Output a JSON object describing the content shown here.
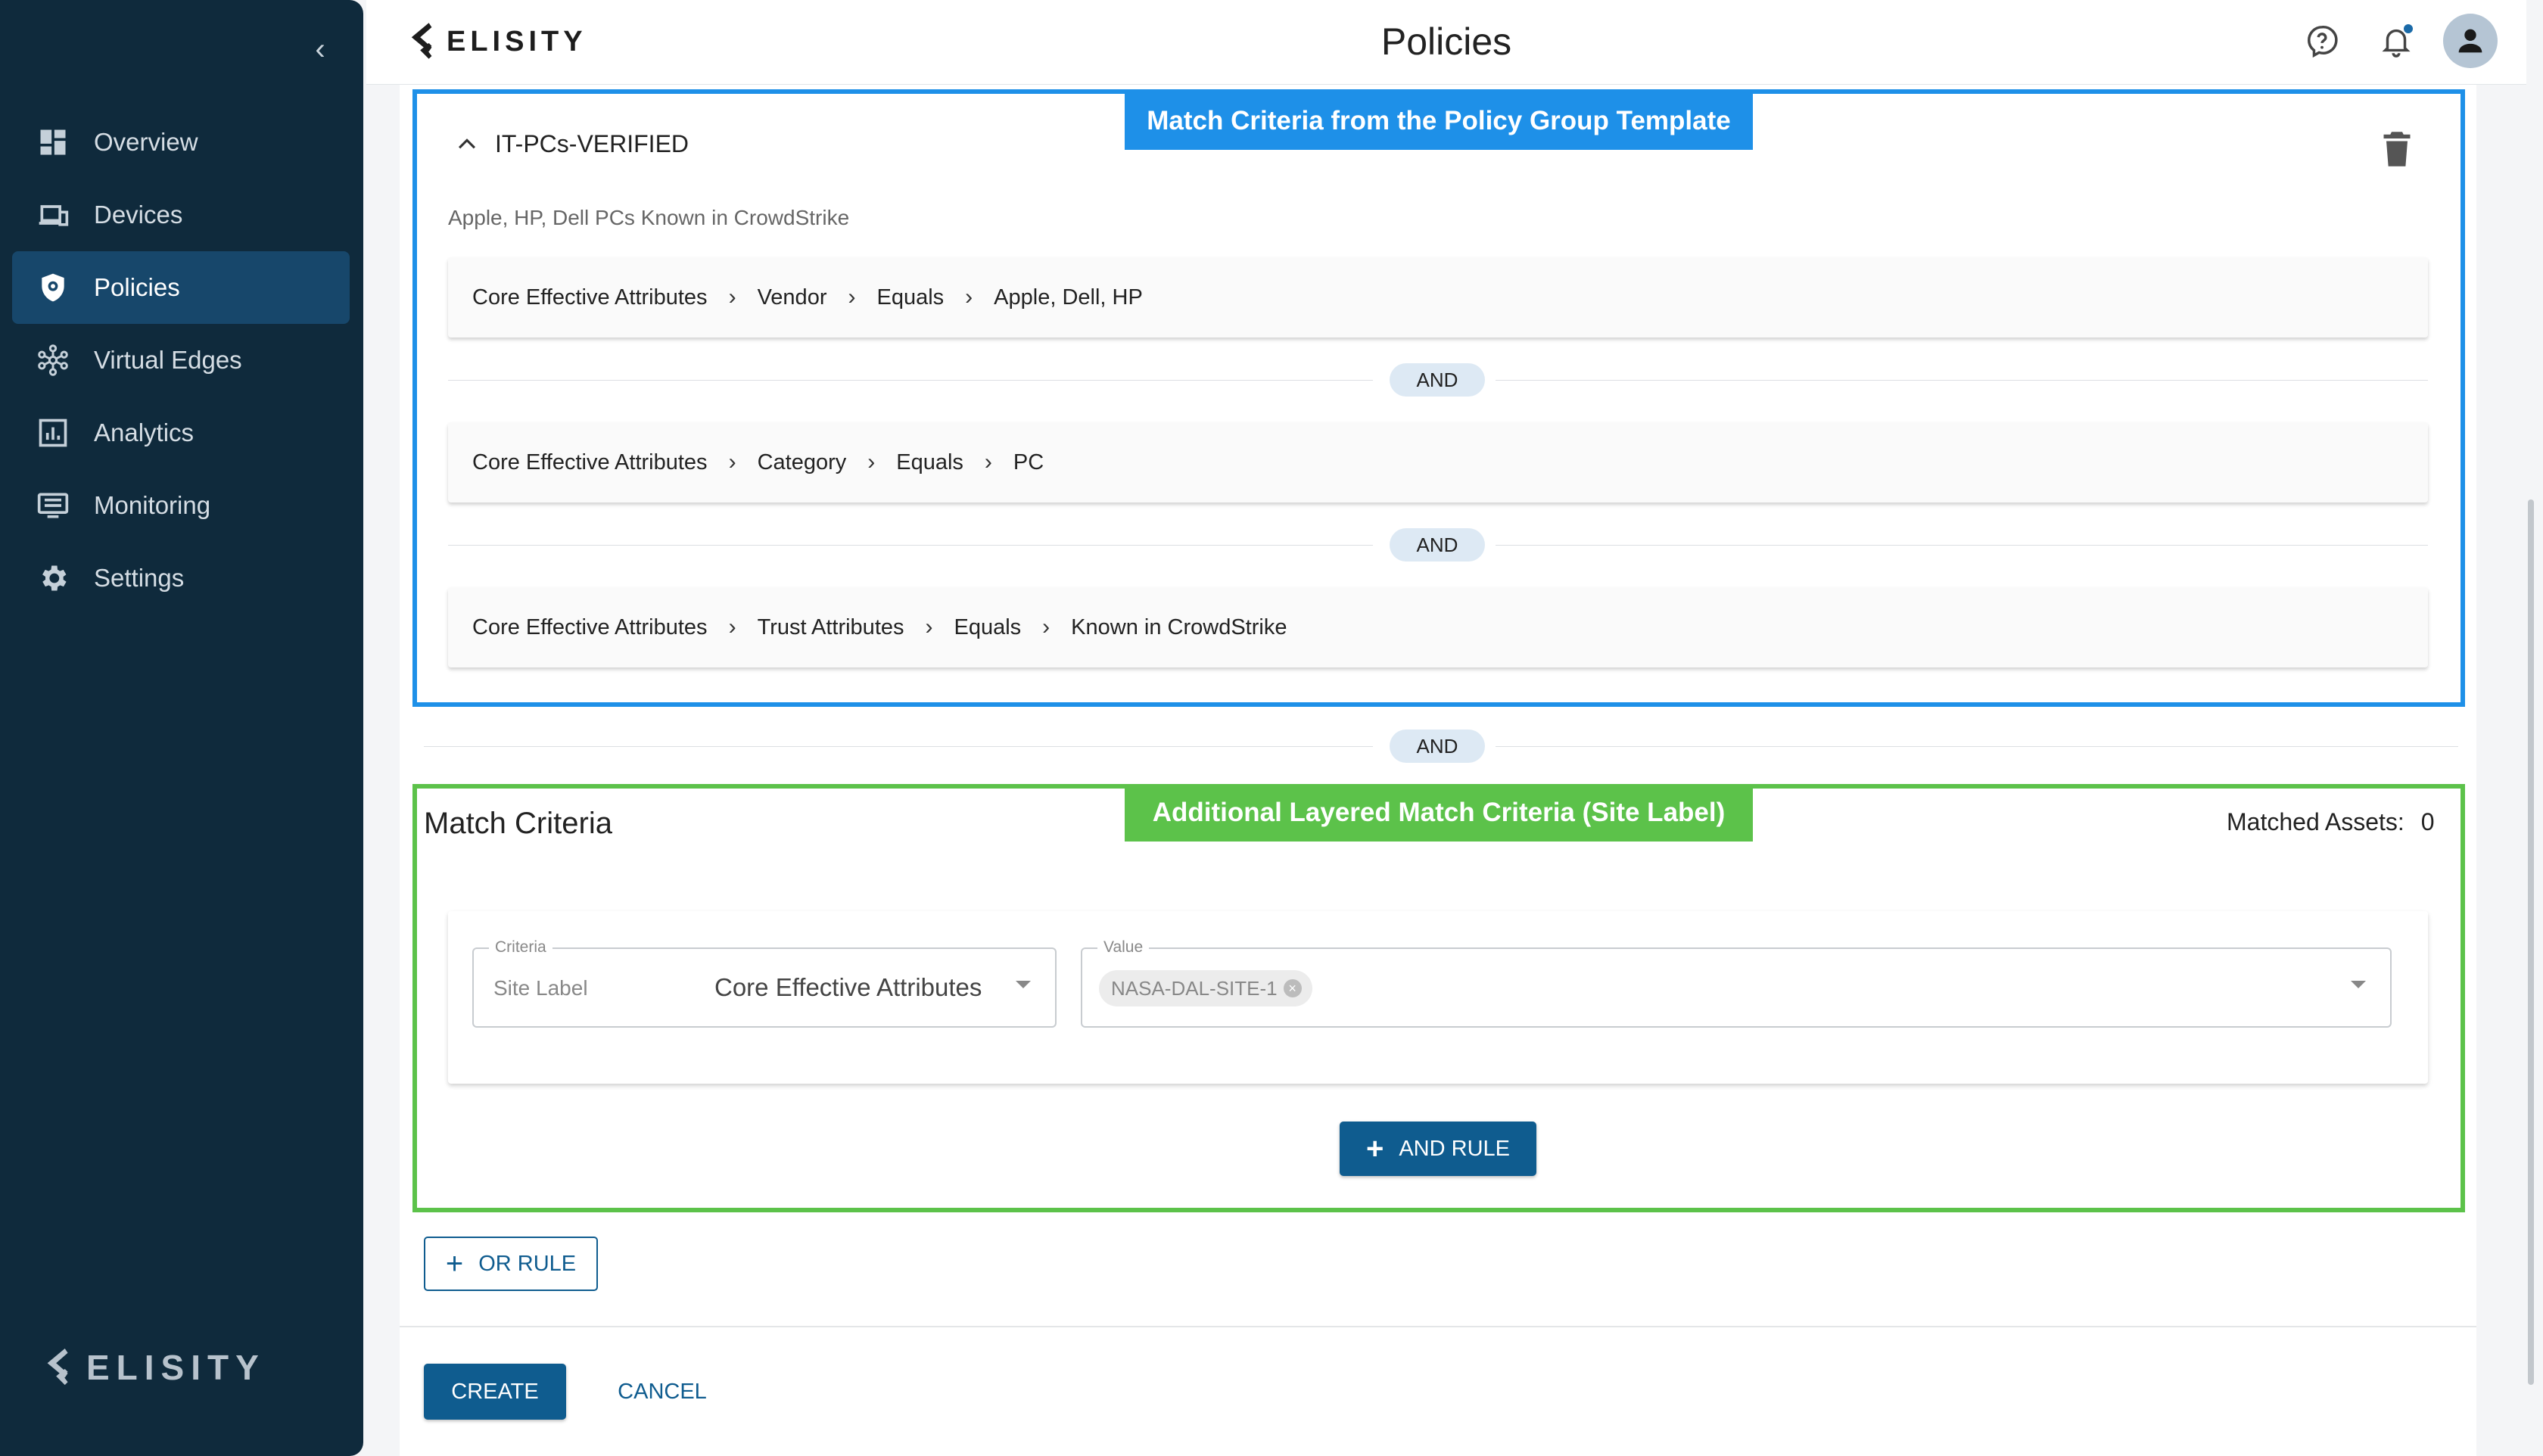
{
  "app": {
    "brand": "ELISITY",
    "page_title": "Policies"
  },
  "sidebar": {
    "collapse_icon": "chevron-left-icon",
    "items": [
      {
        "label": "Overview",
        "icon": "dashboard-icon",
        "active": false
      },
      {
        "label": "Devices",
        "icon": "devices-icon",
        "active": false
      },
      {
        "label": "Policies",
        "icon": "shield-icon",
        "active": true
      },
      {
        "label": "Virtual Edges",
        "icon": "hub-icon",
        "active": false
      },
      {
        "label": "Analytics",
        "icon": "analytics-icon",
        "active": false
      },
      {
        "label": "Monitoring",
        "icon": "monitor-icon",
        "active": false
      },
      {
        "label": "Settings",
        "icon": "gear-icon",
        "active": false
      }
    ],
    "footer_logo": "ELISITY"
  },
  "annotations": {
    "template_callout": "Match Criteria from the Policy Group Template",
    "layered_callout": "Additional Layered Match Criteria (Site Label)"
  },
  "template_group": {
    "title": "IT-PCs-VERIFIED",
    "description": "Apple, HP, Dell PCs Known in CrowdStrike",
    "rules": [
      {
        "parts": [
          "Core Effective Attributes",
          "Vendor",
          "Equals",
          "Apple, Dell, HP"
        ]
      },
      {
        "parts": [
          "Core Effective Attributes",
          "Category",
          "Equals",
          "PC"
        ]
      },
      {
        "parts": [
          "Core Effective Attributes",
          "Trust Attributes",
          "Equals",
          "Known in CrowdStrike"
        ]
      }
    ],
    "and_label": "AND"
  },
  "between_and_label": "AND",
  "match_criteria": {
    "title": "Match Criteria",
    "matched_assets_label": "Matched Assets:",
    "matched_assets_count": "0",
    "criteria_legend": "Criteria",
    "criteria_placeholder": "Site Label",
    "criteria_value": "Core Effective Attributes",
    "value_legend": "Value",
    "value_chip": "NASA-DAL-SITE-1",
    "and_rule_button": "AND RULE"
  },
  "actions": {
    "or_rule": "OR RULE",
    "create": "CREATE",
    "cancel": "CANCEL"
  },
  "colors": {
    "sidebar_bg": "#0f2a3c",
    "primary": "#0f5c8f",
    "template_box": "#1e90e8",
    "layered_box": "#5cc24a"
  }
}
